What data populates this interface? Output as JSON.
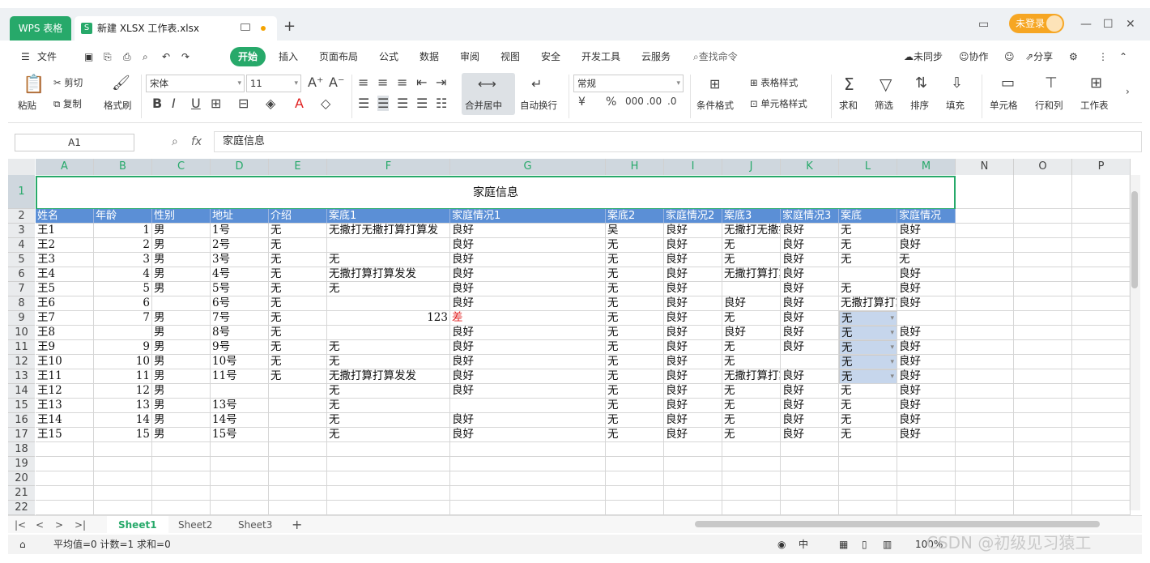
{
  "titlebar": {
    "app_tab": "WPS 表格",
    "doc_title": "新建 XLSX 工作表.xlsx",
    "login": "未登录"
  },
  "menu": [
    "文件",
    "开始",
    "插入",
    "页面布局",
    "公式",
    "数据",
    "审阅",
    "视图",
    "安全",
    "开发工具",
    "云服务"
  ],
  "menu_search": "查找命令",
  "menu_right": [
    "未同步",
    "协作",
    "分享"
  ],
  "ribbon": {
    "paste": "粘贴",
    "cut": "剪切",
    "copy": "复制",
    "format_painter": "格式刷",
    "font_name": "宋体",
    "font_size": "11",
    "merge": "合并居中",
    "wrap": "自动换行",
    "number_format": "常规",
    "conditional": "条件格式",
    "table_style": "表格样式",
    "cell_style": "单元格样式",
    "sum": "求和",
    "filter": "筛选",
    "sort": "排序",
    "fill": "填充",
    "cell": "单元格",
    "rowcol": "行和列",
    "worksheet": "工作表"
  },
  "formula_bar": {
    "name_box": "A1",
    "content": "家庭信息"
  },
  "columns": [
    "A",
    "B",
    "C",
    "D",
    "E",
    "F",
    "G",
    "H",
    "I",
    "J",
    "K",
    "L",
    "M",
    "N",
    "O",
    "P"
  ],
  "rows": [
    "1",
    "2",
    "3",
    "4",
    "5",
    "6",
    "7",
    "8",
    "9",
    "10",
    "11",
    "12",
    "13",
    "14",
    "15",
    "16",
    "17",
    "18",
    "19",
    "20",
    "21",
    "22"
  ],
  "sheet_title": "家庭信息",
  "headers": [
    "姓名",
    "年龄",
    "性别",
    "地址",
    "介绍",
    "案底1",
    "家庭情况1",
    "案底2",
    "家庭情况2",
    "案底3",
    "家庭情况3",
    "案底",
    "家庭情况"
  ],
  "data_rows": [
    [
      "王1",
      "1",
      "男",
      "1号",
      "无",
      "无撒打无撒打算打算发",
      "良好",
      "吴",
      "良好",
      "无撒打无撒打算打算发",
      "良好",
      "无",
      "良好"
    ],
    [
      "王2",
      "2",
      "男",
      "2号",
      "无",
      "",
      "良好",
      "无",
      "良好",
      "无",
      "良好",
      "无",
      "良好"
    ],
    [
      "王3",
      "3",
      "男",
      "3号",
      "无",
      "无",
      "良好",
      "无",
      "良好",
      "无",
      "良好",
      "无",
      "无"
    ],
    [
      "王4",
      "4",
      "男",
      "4号",
      "无",
      "无撒打算打算发发",
      "良好",
      "无",
      "良好",
      "无撒打算打算发发",
      "良好",
      "",
      "良好"
    ],
    [
      "王5",
      "5",
      "男",
      "5号",
      "无",
      "无",
      "良好",
      "无",
      "良好",
      "",
      "良好",
      "无",
      "良好"
    ],
    [
      "王6",
      "6",
      "",
      "6号",
      "无",
      "",
      "良好",
      "无",
      "良好",
      "良好",
      "良好",
      "无撒打算打算发发",
      "良好"
    ],
    [
      "王7",
      "7",
      "男",
      "7号",
      "无",
      "123",
      "差",
      "无",
      "良好",
      "无",
      "良好",
      "无",
      ""
    ],
    [
      "王8",
      "",
      "男",
      "8号",
      "无",
      "",
      "良好",
      "无",
      "良好",
      "良好",
      "良好",
      "无",
      "良好"
    ],
    [
      "王9",
      "9",
      "男",
      "9号",
      "无",
      "无",
      "良好",
      "无",
      "良好",
      "无",
      "良好",
      "无",
      "良好"
    ],
    [
      "王10",
      "10",
      "男",
      "10号",
      "无",
      "无",
      "良好",
      "无",
      "良好",
      "无",
      "",
      "无",
      "良好"
    ],
    [
      "王11",
      "11",
      "男",
      "11号",
      "无",
      "无撒打算打算发发",
      "良好",
      "无",
      "良好",
      "无撒打算打算发发",
      "良好",
      "无",
      "良好"
    ],
    [
      "王12",
      "12",
      "男",
      "",
      "",
      "无",
      "良好",
      "无",
      "良好",
      "无",
      "良好",
      "无",
      "良好"
    ],
    [
      "王13",
      "13",
      "男",
      "13号",
      "",
      "无",
      "",
      "无",
      "良好",
      "无",
      "良好",
      "无",
      "良好"
    ],
    [
      "王14",
      "14",
      "男",
      "14号",
      "",
      "无",
      "良好",
      "无",
      "良好",
      "无",
      "良好",
      "无",
      "良好"
    ],
    [
      "王15",
      "15",
      "男",
      "15号",
      "",
      "无",
      "良好",
      "无",
      "良好",
      "无",
      "良好",
      "无",
      "良好"
    ]
  ],
  "sheets": [
    "Sheet1",
    "Sheet2",
    "Sheet3"
  ],
  "status": {
    "text": "平均值=0  计数=1  求和=0",
    "zoom": "100%",
    "lang": "中"
  },
  "watermark": "CSDN @初级见习猿工",
  "colors": {
    "brand": "#27a96a",
    "header_fill": "#5b8fd6",
    "selection": "#c6d6ec",
    "bad": "#e02020"
  }
}
